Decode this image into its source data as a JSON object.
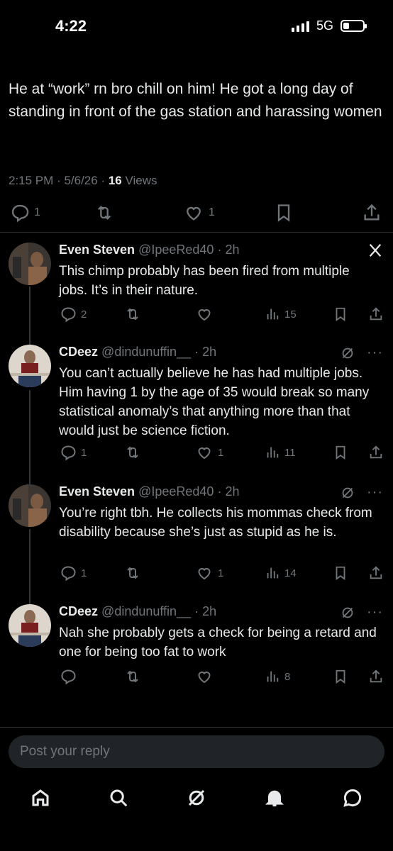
{
  "status_bar": {
    "time": "4:22",
    "network": "5G"
  },
  "main_tweet": {
    "text": "He at “work” rn bro chill on him! He got a long day of standing in front of the gas station and harassing women",
    "time": "2:15 PM",
    "date": "5/6/26",
    "views_count": "16",
    "views_label": "Views",
    "replies": "1",
    "likes": "1"
  },
  "replies": [
    {
      "name": "Even Steven",
      "handle": "@IpeeRed40",
      "age": "2h",
      "text": "This chimp probably has been fired from multiple jobs. It’s in their nature.",
      "replies": "2",
      "likes": "",
      "views": "15"
    },
    {
      "name": "CDeez",
      "handle": "@dindunuffin__",
      "age": "2h",
      "text": "You can’t actually believe he has had multiple jobs. Him having 1 by the age of 35 would break so many statistical anomaly’s that anything more than that would just be science fiction.",
      "replies": "1",
      "likes": "1",
      "views": "11"
    },
    {
      "name": "Even Steven",
      "handle": "@IpeeRed40",
      "age": "2h",
      "text": "You’re right tbh. He collects his mommas check from disability because she’s just as stupid as he is.",
      "replies": "1",
      "likes": "1",
      "views": "14"
    },
    {
      "name": "CDeez",
      "handle": "@dindunuffin__",
      "age": "2h",
      "text": "Nah she probably gets a check for being a retard and one for being too fat to work",
      "replies": "",
      "likes": "",
      "views": "8"
    }
  ],
  "reply_input": {
    "placeholder": "Post your reply"
  },
  "icons": {
    "home": "home-icon",
    "search": "search-icon",
    "grok": "grok-icon",
    "notifications": "bell-icon",
    "messages": "message-icon"
  },
  "colors": {
    "background": "#000000",
    "text": "#e7e9ea",
    "muted": "#71767b",
    "divider": "#2f3336"
  }
}
